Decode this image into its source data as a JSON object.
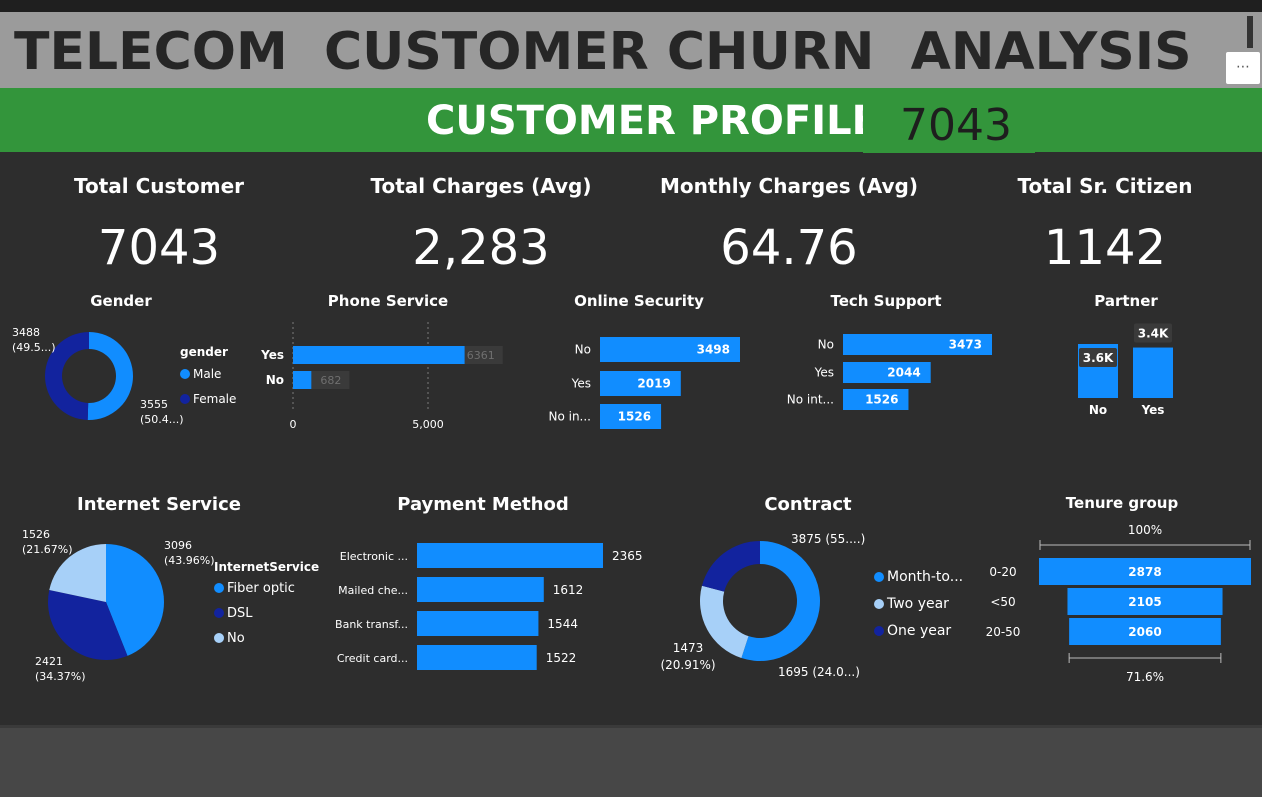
{
  "header": {
    "title": "TELECOM  CUSTOMER CHURN  ANALYSIS",
    "more_label": "⋯",
    "profile_title": "CUSTOMER PROFILE",
    "profile_count": "7043"
  },
  "colors": {
    "green": "#33953b",
    "blue": "#118dff",
    "navy": "#12239e",
    "light_blue": "#a7d0f8",
    "background": "#2d2d2d"
  },
  "kpis": [
    {
      "label": "Total Customer",
      "value": "7043"
    },
    {
      "label": "Total Charges (Avg)",
      "value": "2,283"
    },
    {
      "label": "Monthly Charges (Avg)",
      "value": "64.76"
    },
    {
      "label": "Total Sr. Citizen",
      "value": "1142"
    }
  ],
  "chart_data": [
    {
      "type": "pie",
      "title": "Gender",
      "legend_title": "gender",
      "categories": [
        "Male",
        "Female"
      ],
      "values": [
        3555,
        3488
      ],
      "labels": [
        "3555\n(50.4...)",
        "3488\n(49.5...)"
      ]
    },
    {
      "type": "bar",
      "title": "Phone Service",
      "categories": [
        "Yes",
        "No"
      ],
      "values": [
        6361,
        682
      ],
      "ticks": [
        "0",
        "5,000"
      ],
      "xlim": [
        0,
        6800
      ]
    },
    {
      "type": "bar",
      "title": "Online Security",
      "categories": [
        "No",
        "Yes",
        "No in..."
      ],
      "values": [
        3498,
        2019,
        1526
      ]
    },
    {
      "type": "bar",
      "title": "Tech Support",
      "categories": [
        "No",
        "Yes",
        "No int..."
      ],
      "values": [
        3473,
        2044,
        1526
      ]
    },
    {
      "type": "bar",
      "title": "Partner",
      "categories": [
        "No",
        "Yes"
      ],
      "values": [
        3641,
        3402
      ],
      "labels": [
        "3.6K",
        "3.4K"
      ]
    },
    {
      "type": "pie",
      "title": "Internet Service",
      "legend_title": "InternetService",
      "categories": [
        "Fiber optic",
        "DSL",
        "No"
      ],
      "values": [
        3096,
        2421,
        1526
      ],
      "labels": [
        "3096\n(43.96%)",
        "2421\n(34.37%)",
        "1526\n(21.67%)"
      ]
    },
    {
      "type": "bar",
      "title": "Payment Method",
      "categories": [
        "Electronic ...",
        "Mailed che...",
        "Bank transf...",
        "Credit card..."
      ],
      "values": [
        2365,
        1612,
        1544,
        1522
      ]
    },
    {
      "type": "pie",
      "title": "Contract",
      "categories": [
        "Month-to...",
        "Two year",
        "One year"
      ],
      "values": [
        3875,
        1695,
        1473
      ],
      "labels": [
        "3875 (55....)",
        "1695 (24.0...)",
        "1473\n(20.91%)"
      ]
    },
    {
      "type": "bar",
      "title": "Tenure group",
      "categories": [
        "0-20",
        "<50",
        "20-50"
      ],
      "values": [
        2878,
        2105,
        2060
      ],
      "top_label": "100%",
      "bottom_label": "71.6%"
    }
  ]
}
